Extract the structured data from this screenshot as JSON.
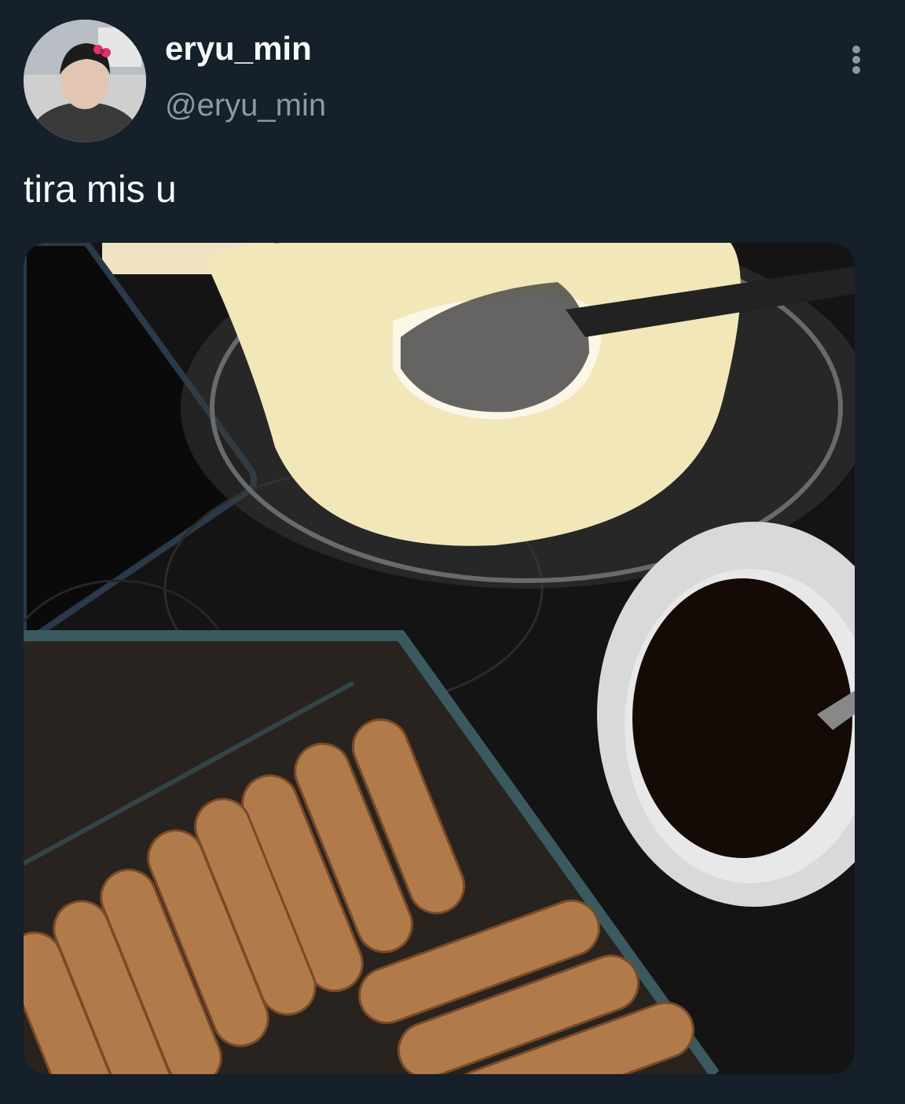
{
  "author": {
    "display_name": "eryu_min",
    "handle": "@eryu_min",
    "avatar_icon": "profile-photo"
  },
  "tweet": {
    "text": "tira mis u"
  },
  "menu": {
    "icon": "more-vertical-icon"
  },
  "media": {
    "description_icon": "photo"
  },
  "colors": {
    "background": "#15202b",
    "primary_text": "#f7f9f9",
    "secondary_text": "#8b98a5"
  }
}
